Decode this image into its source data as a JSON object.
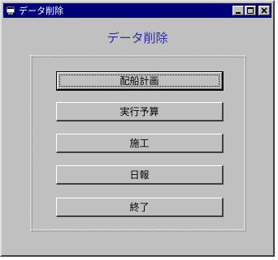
{
  "window": {
    "title": "データ削除",
    "controls": {
      "minimize": "minimize-icon",
      "maximize": "maximize-icon",
      "close": "close-icon"
    }
  },
  "heading": "データ削除",
  "buttons": {
    "b1": "配船計画",
    "b2": "実行予算",
    "b3": "施工",
    "b4": "日報",
    "b5": "終了"
  }
}
